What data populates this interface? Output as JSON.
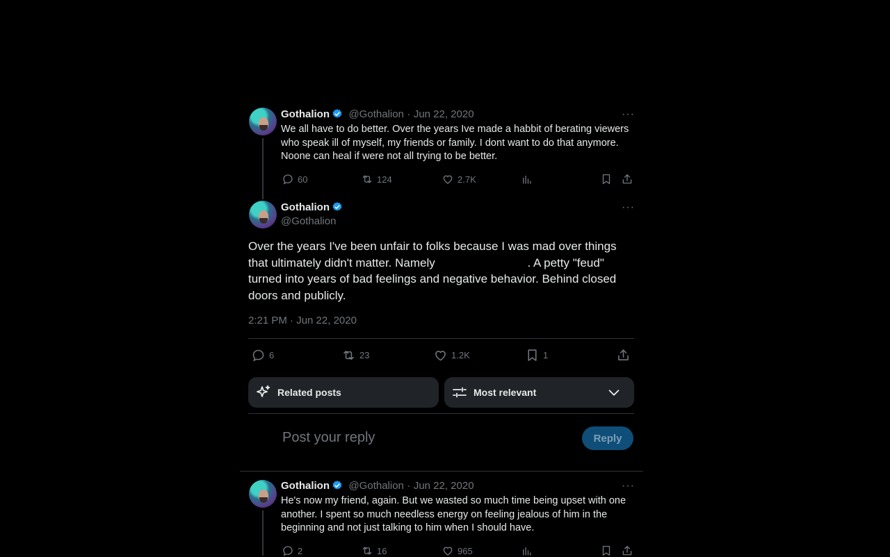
{
  "tweets": [
    {
      "name": "Gothalion",
      "handle": "@Gothalion",
      "date": "Jun 22, 2020",
      "more": "···",
      "text": "We all have to do better. Over the years Ive made a habbit of berating viewers who speak ill of myself, my friends or family. I dont want to do that anymore. Noone can heal if were not all trying to be better.",
      "replies": "60",
      "reposts": "124",
      "likes": "2.7K"
    },
    {
      "name": "Gothalion",
      "handle": "@Gothalion",
      "date": "Jun 22, 2020",
      "more": "···",
      "text": "He's now my friend, again. But we wasted so much time being upset with one another. I spent so much needless energy on feeling jealous of him in the beginning and not just talking to him when I should have.",
      "replies": "2",
      "reposts": "16",
      "likes": "965"
    }
  ],
  "main_post": {
    "name": "Gothalion",
    "handle": "@Gothalion",
    "more": "···",
    "text_part1": "Over the years I've been unfair to folks because I was mad over things that ultimately didn't matter. Namely",
    "text_part2": ". A petty \"feud\" turned into years of bad feelings and negative behavior. Behind closed doors and publicly.",
    "timestamp": "2:21 PM · Jun 22, 2020",
    "replies": "6",
    "reposts": "23",
    "likes": "1.2K",
    "bookmarks": "1"
  },
  "filters": {
    "related_label": "Related posts",
    "sort_label": "Most relevant"
  },
  "composer": {
    "placeholder": "Post your reply",
    "reply_label": "Reply"
  },
  "colors": {
    "background": "#000000",
    "verified": "#1d9bf0",
    "reply_button": "#0f4e78",
    "muted": "#71767b"
  }
}
